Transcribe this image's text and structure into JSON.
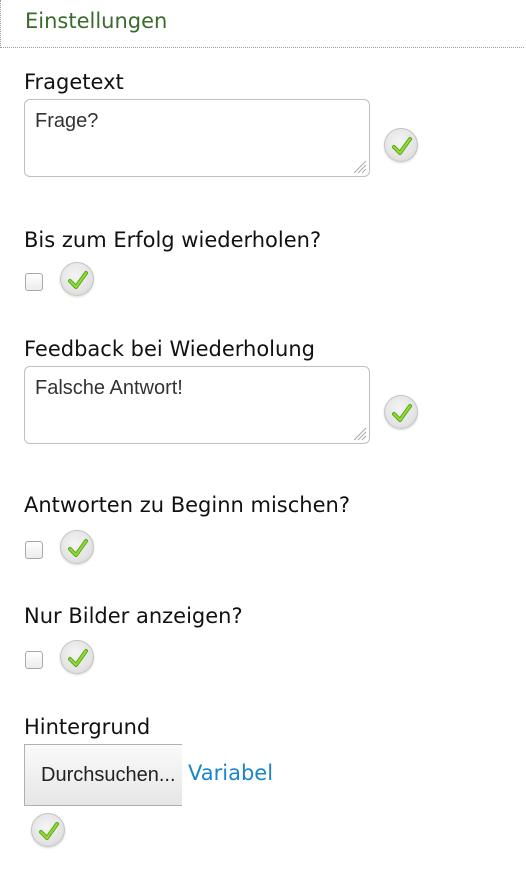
{
  "header": {
    "title": "Einstellungen"
  },
  "fields": {
    "fragetext": {
      "label": "Fragetext",
      "value": "Frage?"
    },
    "bis_zum_erfolg": {
      "label": "Bis zum Erfolg wiederholen?",
      "checked": false
    },
    "feedback": {
      "label": "Feedback bei Wiederholung",
      "value": "Falsche Antwort!"
    },
    "antworten_mischen": {
      "label": "Antworten zu Beginn mischen?",
      "checked": false
    },
    "nur_bilder": {
      "label": "Nur Bilder anzeigen?",
      "checked": false
    },
    "hintergrund": {
      "label": "Hintergrund",
      "button_label": "Durchsuchen...",
      "link_label": "Variabel"
    }
  },
  "icons": {
    "confirm": "check-icon",
    "check_color": "#7cc41f",
    "accent": "#3b6a2e",
    "link_color": "#1a86c8"
  }
}
